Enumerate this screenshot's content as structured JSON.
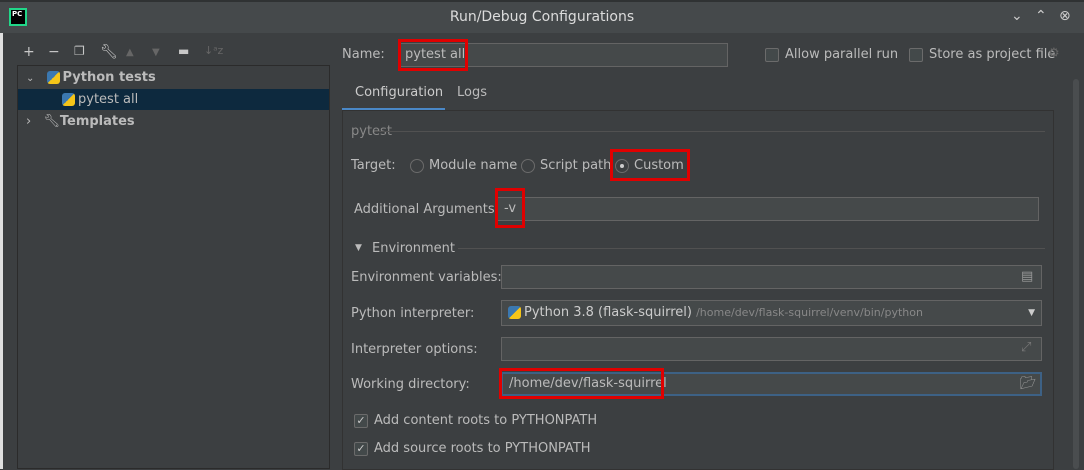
{
  "window": {
    "title": "Run/Debug Configurations",
    "logo": "PC"
  },
  "toolbar": {
    "icons": [
      "plus-icon",
      "minus-icon",
      "copy-icon",
      "wrench-icon",
      "arrow-up-icon",
      "arrow-down-icon",
      "folder-add-icon",
      "sort-az-icon"
    ]
  },
  "tree": {
    "group": "Python tests",
    "item": "pytest all",
    "templates": "Templates"
  },
  "name": {
    "label": "Name:",
    "value": "pytest all"
  },
  "options": {
    "parallel": "Allow parallel run",
    "store": "Store as project file"
  },
  "tabs": [
    "Configuration",
    "Logs"
  ],
  "section": "pytest",
  "target": {
    "label": "Target:",
    "options": [
      "Module name",
      "Script path",
      "Custom"
    ],
    "selected": "Custom"
  },
  "additional": {
    "label": "Additional Arguments:",
    "value": "-v"
  },
  "environment": {
    "header": "Environment",
    "env_label": "Environment variables:",
    "env_value": "",
    "interp_label": "Python interpreter:",
    "interp_name": "Python 3.8 (flask-squirrel)",
    "interp_path": "/home/dev/flask-squirrel/venv/bin/python",
    "opts_label": "Interpreter options:",
    "opts_value": "",
    "wd_label": "Working directory:",
    "wd_value": "/home/dev/flask-squirrel"
  },
  "checks": [
    {
      "label": "Add content roots to PYTHONPATH",
      "checked": true
    },
    {
      "label": "Add source roots to PYTHONPATH",
      "checked": true
    }
  ],
  "colors": {
    "highlight": "#e00000",
    "selection": "#0d293e",
    "focus": "#3d6185"
  }
}
